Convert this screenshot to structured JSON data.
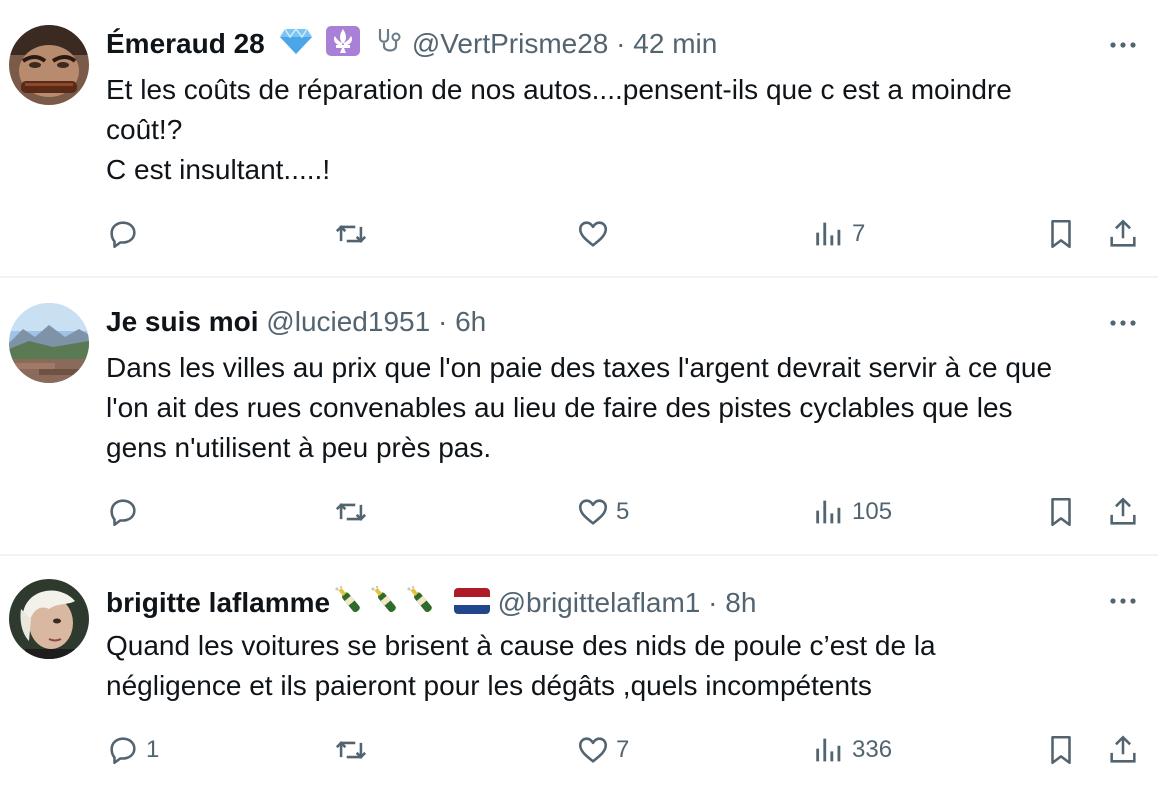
{
  "tweets": [
    {
      "author_name": "Émeraud 28",
      "handle": "@VertPrisme28",
      "separator": "·",
      "time": "42 min",
      "badges": [
        "gem-icon",
        "fleur-de-lis-icon",
        "stethoscope-icon"
      ],
      "text_lines": [
        "Et les coûts de réparation de nos autos....pensent-ils que c est a moindre",
        "coût!?",
        "C est insultant.....!"
      ],
      "reply_count": "",
      "retweet_count": "",
      "like_count": "",
      "view_count": "7"
    },
    {
      "author_name": "Je suis moi",
      "handle": "@lucied1951",
      "separator": "·",
      "time": "6h",
      "badges": [],
      "text_lines": [
        "Dans les villes au prix que l'on paie des taxes l'argent devrait servir à ce que",
        "l'on ait des rues convenables au lieu de faire des pistes cyclables que les",
        "gens n'utilisent à peu près pas."
      ],
      "reply_count": "",
      "retweet_count": "",
      "like_count": "5",
      "view_count": "105"
    },
    {
      "author_name": "brigitte laflamme",
      "handle": "@brigittelaflam1",
      "separator": "·",
      "time": "8h",
      "badges": [
        "champagne-icon",
        "champagne-icon",
        "champagne-icon",
        "netherlands-flag-icon"
      ],
      "text_lines": [
        "Quand les voitures se brisent à cause des nids de poule c’est de la",
        "négligence et ils paieront pour les dégâts ,quels incompétents"
      ],
      "reply_count": "1",
      "retweet_count": "",
      "like_count": "7",
      "view_count": "336"
    }
  ],
  "colors": {
    "text": "#0f1419",
    "secondary": "#536471",
    "divider": "#eff3f4"
  }
}
